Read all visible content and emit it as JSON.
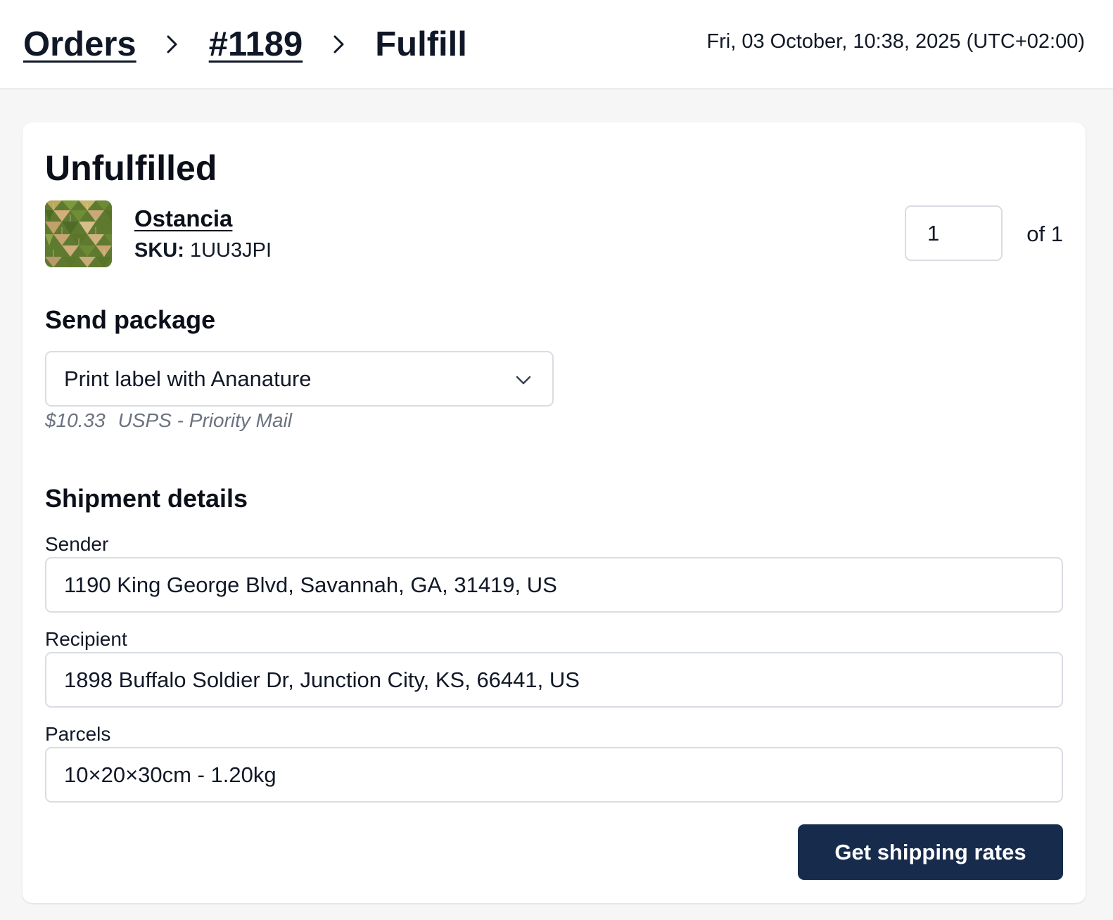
{
  "breadcrumb": {
    "items": [
      {
        "label": "Orders",
        "link": true
      },
      {
        "label": "#1189",
        "link": true
      },
      {
        "label": "Fulfill",
        "link": false
      }
    ],
    "separator_icon": "chevron-right-icon"
  },
  "header": {
    "datetime": "Fri, 03 October, 10:38, 2025 (UTC+02:00)"
  },
  "fulfillment": {
    "status_title": "Unfulfilled",
    "product": {
      "name": "Ostancia",
      "sku_label": "SKU:",
      "sku_value": "1UU3JPI",
      "thumbnail_icon": "product-thumbnail"
    },
    "quantity": {
      "value": "1",
      "of_text": "of 1"
    }
  },
  "send_package": {
    "title": "Send package",
    "selected_option": "Print label with Ananature",
    "dropdown_icon": "chevron-down-icon",
    "rate_price": "$10.33",
    "rate_service": "USPS - Priority Mail"
  },
  "shipment_details": {
    "title": "Shipment details",
    "sender": {
      "label": "Sender",
      "value": "1190 King George Blvd, Savannah, GA, 31419, US"
    },
    "recipient": {
      "label": "Recipient",
      "value": "1898 Buffalo Soldier Dr, Junction City, KS, 66441, US"
    },
    "parcels": {
      "label": "Parcels",
      "value": "10×20×30cm - 1.20kg"
    }
  },
  "actions": {
    "get_rates_label": "Get shipping rates"
  },
  "colors": {
    "primary_button": "#172b4d",
    "hint_text": "#6b7280",
    "page_background": "#f6f6f7"
  }
}
